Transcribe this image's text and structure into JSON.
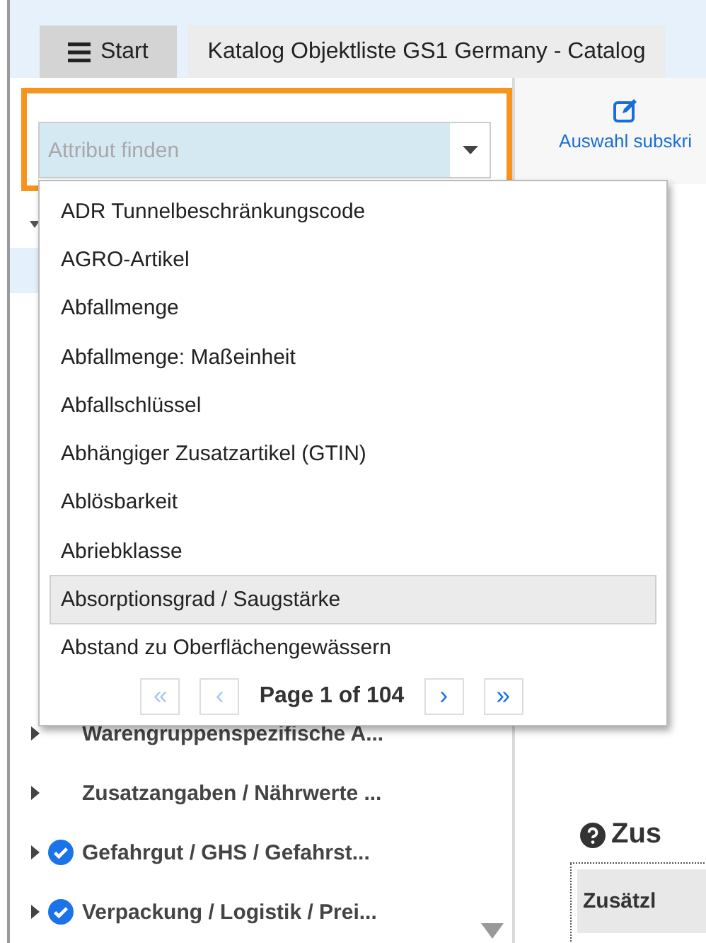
{
  "tabs": [
    {
      "label": "Start",
      "selected": false
    },
    {
      "label": "Katalog Objektliste GS1 Germany - Catalog",
      "selected": true
    }
  ],
  "search": {
    "placeholder": "Attribut finden"
  },
  "toolbar": {
    "button": "Auswahl subskri"
  },
  "dropdown": {
    "items": [
      {
        "label": "ADR Tunnelbeschränkungscode",
        "selected": false
      },
      {
        "label": "AGRO-Artikel",
        "selected": false
      },
      {
        "label": "Abfallmenge",
        "selected": false
      },
      {
        "label": "Abfallmenge: Maßeinheit",
        "selected": false
      },
      {
        "label": "Abfallschlüssel",
        "selected": false
      },
      {
        "label": "Abhängiger Zusatzartikel (GTIN)",
        "selected": false
      },
      {
        "label": "Ablösbarkeit",
        "selected": false
      },
      {
        "label": "Abriebklasse",
        "selected": false
      },
      {
        "label": "Absorptionsgrad / Saugstärke",
        "selected": true
      },
      {
        "label": "Abstand zu Oberflächengewässern",
        "selected": false
      }
    ],
    "pager": {
      "first": {
        "label": "«",
        "disabled": true
      },
      "prev": {
        "label": "‹",
        "disabled": true
      },
      "info": "Page 1 of 104",
      "next": {
        "label": "›",
        "disabled": false
      },
      "last": {
        "label": "»",
        "disabled": false
      }
    }
  },
  "tree": {
    "items": [
      {
        "label": "Warengruppenspezifische A...",
        "checked": false
      },
      {
        "label": "Zusatzangaben / Nährwerte ...",
        "checked": false
      },
      {
        "label": "Gefahrgut / GHS / Gefahrst...",
        "checked": true
      },
      {
        "label": "Verpackung / Logistik / Prei...",
        "checked": true
      }
    ]
  },
  "section": {
    "title": "Zus",
    "columns": [
      "Zusätzl"
    ]
  }
}
